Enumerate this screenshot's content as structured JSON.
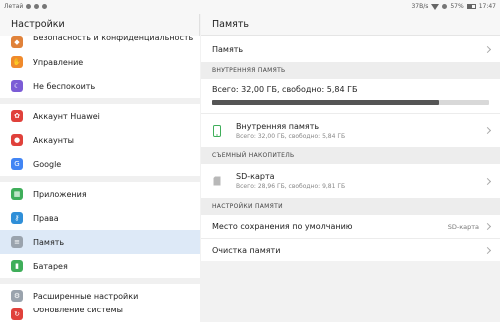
{
  "statusbar": {
    "carrier": "Летай",
    "speed": "37B/s",
    "battery": "57%",
    "time": "17:47"
  },
  "left": {
    "title": "Настройки",
    "groups": [
      [
        {
          "label": "Безопасность и конфиденциальность",
          "icon": "shield-icon",
          "color": "#e0823a",
          "cut": true
        },
        {
          "label": "Управление",
          "icon": "hand-icon",
          "color": "#f08a2c"
        },
        {
          "label": "Не беспокоить",
          "icon": "moon-icon",
          "color": "#7b5cd6"
        }
      ],
      [
        {
          "label": "Аккаунт Huawei",
          "icon": "huawei-icon",
          "color": "#e0413b"
        },
        {
          "label": "Аккаунты",
          "icon": "person-icon",
          "color": "#e0413b"
        },
        {
          "label": "Google",
          "icon": "google-icon",
          "color": "#4285f4"
        }
      ],
      [
        {
          "label": "Приложения",
          "icon": "apps-grid-icon",
          "color": "#3fae5a"
        },
        {
          "label": "Права",
          "icon": "key-icon",
          "color": "#2f8fd8"
        },
        {
          "label": "Память",
          "icon": "storage-icon",
          "color": "#9aa3ad",
          "selected": true
        },
        {
          "label": "Батарея",
          "icon": "battery-icon",
          "color": "#3fae5a"
        }
      ],
      [
        {
          "label": "Расширенные настройки",
          "icon": "gear-icon",
          "color": "#9aa3ad"
        },
        {
          "label": "Обновление системы",
          "icon": "update-icon",
          "color": "#e0413b",
          "cut": true
        }
      ]
    ]
  },
  "right": {
    "title": "Память",
    "memory_row": "Память",
    "section_internal": "ВНУТРЕННЯЯ ПАМЯТЬ",
    "totals": "Всего: 32,00 ГБ, свободно: 5,84 ГБ",
    "used_fraction": 0.82,
    "internal": {
      "name": "Внутренняя память",
      "detail": "Всего: 32,00 ГБ, свободно: 5,84 ГБ"
    },
    "section_removable": "СЪЕМНЫЙ НАКОПИТЕЛЬ",
    "sd": {
      "name": "SD-карта",
      "detail": "Всего: 28,96 ГБ, свободно: 9,81 ГБ"
    },
    "section_settings": "НАСТРОЙКИ ПАМЯТИ",
    "default_location": {
      "label": "Место сохранения по умолчанию",
      "value": "SD-карта"
    },
    "cleanup": "Очистка памяти"
  },
  "colors": {
    "accent_green": "#3fae5a",
    "selected_bg": "#dde9f7"
  }
}
